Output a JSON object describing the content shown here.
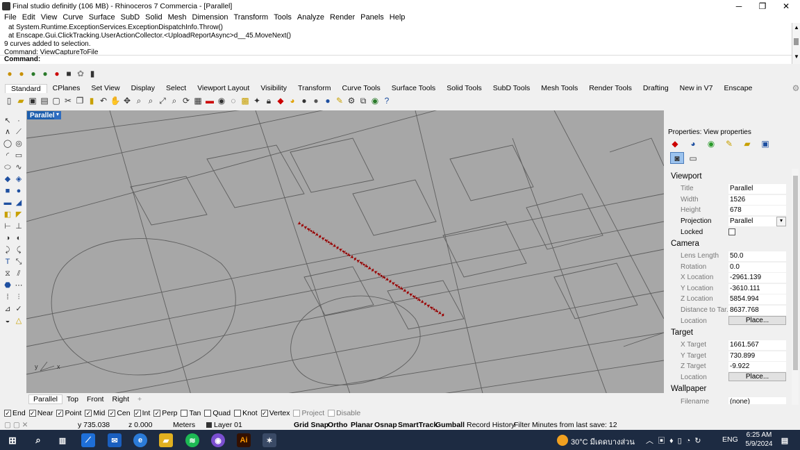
{
  "window": {
    "title": "Final studio definitly (106 MB) - Rhinoceros 7 Commercia - [Parallel]",
    "minimize": "─",
    "maximize": "❐",
    "close": "✕"
  },
  "menu": [
    "File",
    "Edit",
    "View",
    "Curve",
    "Surface",
    "SubD",
    "Solid",
    "Mesh",
    "Dimension",
    "Transform",
    "Tools",
    "Analyze",
    "Render",
    "Panels",
    "Help"
  ],
  "command": {
    "history": [
      "at System.Runtime.ExceptionServices.ExceptionDispatchInfo.Throw()",
      "at Enscape.Gui.ClickTracking.UserActionCollector.<UploadReportAsync>d__45.MoveNext()",
      "9 curves added to selection.",
      "Command: ViewCaptureToFile"
    ],
    "prompt": "Command:"
  },
  "toolbar_tabs": [
    "Standard",
    "CPlanes",
    "Set View",
    "Display",
    "Select",
    "Viewport Layout",
    "Visibility",
    "Transform",
    "Curve Tools",
    "Surface Tools",
    "Solid Tools",
    "SubD Tools",
    "Mesh Tools",
    "Render Tools",
    "Drafting",
    "New in V7",
    "Enscape"
  ],
  "viewport": {
    "name": "Parallel",
    "tabs": [
      "Parallel",
      "Top",
      "Front",
      "Right"
    ],
    "add": "+",
    "axis_y": "y",
    "axis_x": "x"
  },
  "osnap": [
    {
      "label": "End",
      "checked": true,
      "enabled": true
    },
    {
      "label": "Near",
      "checked": true,
      "enabled": true
    },
    {
      "label": "Point",
      "checked": true,
      "enabled": true
    },
    {
      "label": "Mid",
      "checked": true,
      "enabled": true
    },
    {
      "label": "Cen",
      "checked": true,
      "enabled": true
    },
    {
      "label": "Int",
      "checked": true,
      "enabled": true
    },
    {
      "label": "Perp",
      "checked": true,
      "enabled": true
    },
    {
      "label": "Tan",
      "checked": false,
      "enabled": true
    },
    {
      "label": "Quad",
      "checked": false,
      "enabled": true
    },
    {
      "label": "Knot",
      "checked": false,
      "enabled": true
    },
    {
      "label": "Vertex",
      "checked": true,
      "enabled": true
    },
    {
      "label": "Project",
      "checked": false,
      "enabled": false
    },
    {
      "label": "Disable",
      "checked": false,
      "enabled": false
    }
  ],
  "status": {
    "y": "y 735.038",
    "z": "z 0.000",
    "units": "Meters",
    "layer": "Layer 01",
    "grid_snap": "Grid Snap",
    "ortho": "Ortho",
    "planar": "Planar",
    "osnap": "Osnap",
    "smarttrack": "SmartTrack",
    "gumball": "Gumball",
    "record_history": "Record History",
    "filter": "Filter",
    "minutes": "Minutes from last save: 12"
  },
  "properties": {
    "header": "Properties: View properties",
    "viewport_section": "Viewport",
    "title_label": "Title",
    "title": "Parallel",
    "width_label": "Width",
    "width": "1526",
    "height_label": "Height",
    "height": "678",
    "projection_label": "Projection",
    "projection": "Parallel",
    "locked_label": "Locked",
    "camera_section": "Camera",
    "lens_label": "Lens Length",
    "lens": "50.0",
    "rotation_label": "Rotation",
    "rotation": "0.0",
    "xloc_label": "X Location",
    "xloc": "-2961.139",
    "yloc_label": "Y Location",
    "yloc": "-3610.111",
    "zloc_label": "Z Location",
    "zloc": "5854.994",
    "dist_label": "Distance to Tar...",
    "dist": "8637.768",
    "cam_loc_label": "Location",
    "place": "Place...",
    "target_section": "Target",
    "xt_label": "X Target",
    "xt": "1661.567",
    "yt_label": "Y Target",
    "yt": "730.899",
    "zt_label": "Z Target",
    "zt": "-9.922",
    "tgt_loc_label": "Location",
    "wallpaper_section": "Wallpaper",
    "filename_label": "Filename",
    "filename": "(none)"
  },
  "taskbar": {
    "weather": "30°C มีเดดบางส่วน",
    "lang": "ENG",
    "time": "6:25 AM",
    "date": "5/9/2024"
  },
  "colors": {
    "viewport_bg": "#a7a7a7",
    "curve": "#8b0000",
    "taskbar": "#1d2b42",
    "vp_tab": "#1e5fae"
  }
}
